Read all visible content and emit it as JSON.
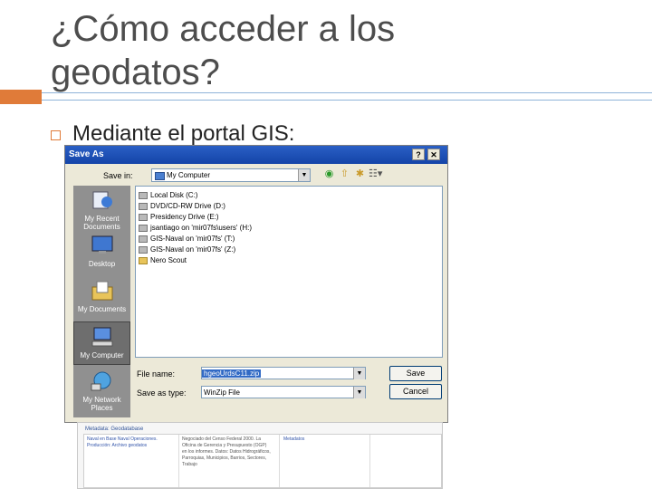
{
  "slide": {
    "title": "¿Cómo acceder a los geodatos?",
    "bullet": "Mediante el portal GIS:"
  },
  "colors": {
    "accent": "#e07b39",
    "rule": "#8fb4d9",
    "title": "#4d4d4d"
  },
  "dialog": {
    "title": "Save As",
    "help_glyph": "?",
    "close_glyph": "✕",
    "save_in_label": "Save in:",
    "save_in_value": "My Computer",
    "toolbar_icons": [
      "back-icon",
      "up-folder-icon",
      "new-folder-icon",
      "views-icon"
    ],
    "places": [
      {
        "label": "My Recent Documents",
        "icon": "recent-documents-icon"
      },
      {
        "label": "Desktop",
        "icon": "desktop-icon"
      },
      {
        "label": "My Documents",
        "icon": "my-documents-icon"
      },
      {
        "label": "My Computer",
        "icon": "my-computer-icon",
        "selected": true
      },
      {
        "label": "My Network Places",
        "icon": "network-places-icon"
      }
    ],
    "files": [
      {
        "label": "Local Disk (C:)",
        "icon": "drive-icon"
      },
      {
        "label": "DVD/CD-RW Drive (D:)",
        "icon": "drive-icon"
      },
      {
        "label": "Presidency Drive (E:)",
        "icon": "drive-icon"
      },
      {
        "label": "jsantiago on 'mir07fs\\users' (H:)",
        "icon": "drive-icon"
      },
      {
        "label": "GIS-Naval on 'mir07fs' (T:)",
        "icon": "drive-icon"
      },
      {
        "label": "GIS-Naval on 'mir07fs' (Z:)",
        "icon": "drive-icon"
      },
      {
        "label": "Nero Scout",
        "icon": "folder-icon"
      }
    ],
    "file_name_label": "File name:",
    "file_name_value": "hgeoUrdsC11.zip",
    "save_as_type_label": "Save as type:",
    "save_as_type_value": "WinZip File",
    "save_button": "Save",
    "cancel_button": "Cancel"
  },
  "webpage": {
    "header": "Metadata: Geodatabase",
    "col1": "Naval en Base Naval Operaciones. Producción: Archivo geodatos",
    "col2": "Negociado del Censo Federal 2000. La Oficina de Gerencia y Presupuesto (OGP) en los informes. Datos: Datos Hidrográficos, Parroquias, Municipios, Barrios, Sectores, Trabajo",
    "col3": "Metadatos"
  }
}
